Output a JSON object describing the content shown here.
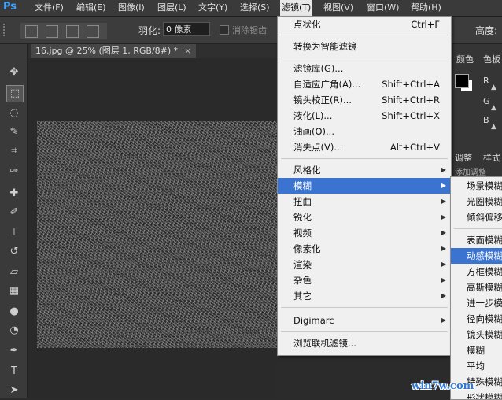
{
  "app": {
    "logo": "Ps"
  },
  "menubar": {
    "items": [
      "文件(F)",
      "编辑(E)",
      "图像(I)",
      "图层(L)",
      "文字(Y)",
      "选择(S)",
      "滤镜(T)",
      "视图(V)",
      "窗口(W)",
      "帮助(H)"
    ],
    "active_index": 6
  },
  "options": {
    "feather_label": "羽化:",
    "feather_value": "0 像素",
    "antialias_label": "消除锯齿",
    "height_label": "高度:"
  },
  "document": {
    "tab_title": "16.jpg @ 25% (图层 1, RGB/8#) *",
    "tab_close": "×"
  },
  "panels": {
    "color_tab": "颜色",
    "swatches_tab": "色板",
    "channels": [
      "R",
      "G",
      "B"
    ],
    "adjust_tab": "调整",
    "style_tab": "样式",
    "adjust_add": "添加调整"
  },
  "filter_menu": {
    "items": [
      {
        "label": "点状化",
        "shortcut": "Ctrl+F"
      },
      {
        "label": "转换为智能滤镜",
        "shortcut": ""
      },
      {
        "label": "滤镜库(G)...",
        "shortcut": ""
      },
      {
        "label": "自适应广角(A)...",
        "shortcut": "Shift+Ctrl+A"
      },
      {
        "label": "镜头校正(R)...",
        "shortcut": "Shift+Ctrl+R"
      },
      {
        "label": "液化(L)...",
        "shortcut": "Shift+Ctrl+X"
      },
      {
        "label": "油画(O)...",
        "shortcut": ""
      },
      {
        "label": "消失点(V)...",
        "shortcut": "Alt+Ctrl+V"
      },
      {
        "label": "风格化",
        "shortcut": ""
      },
      {
        "label": "模糊",
        "shortcut": ""
      },
      {
        "label": "扭曲",
        "shortcut": ""
      },
      {
        "label": "锐化",
        "shortcut": ""
      },
      {
        "label": "视频",
        "shortcut": ""
      },
      {
        "label": "像素化",
        "shortcut": ""
      },
      {
        "label": "渲染",
        "shortcut": ""
      },
      {
        "label": "杂色",
        "shortcut": ""
      },
      {
        "label": "其它",
        "shortcut": ""
      },
      {
        "label": "Digimarc",
        "shortcut": ""
      },
      {
        "label": "浏览联机滤镜...",
        "shortcut": ""
      }
    ],
    "highlighted": "模糊"
  },
  "blur_submenu": {
    "items": [
      "场景模糊",
      "光圈模糊",
      "倾斜偏移",
      "表面模糊",
      "动感模糊",
      "方框模糊",
      "高斯模糊",
      "进一步模",
      "径向模糊",
      "镜头模糊",
      "模糊",
      "平均",
      "特殊模糊",
      "形状模糊"
    ],
    "highlighted": "动感模糊"
  },
  "watermark": "win7w.com"
}
